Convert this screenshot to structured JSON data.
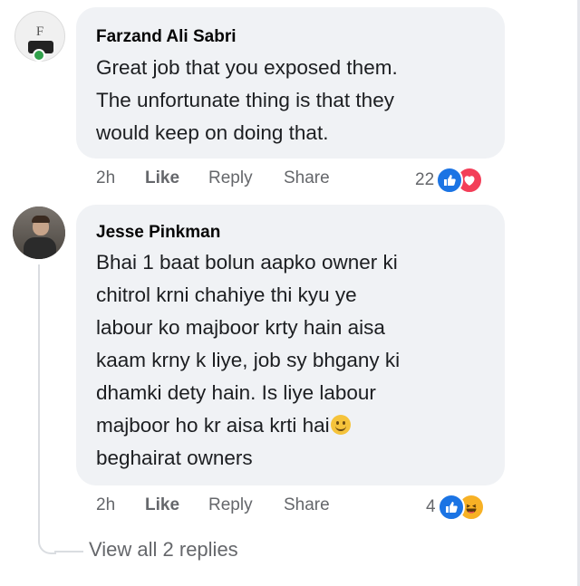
{
  "comments": [
    {
      "author": "Farzand Ali Sabri",
      "avatar_label": "F",
      "text_lines": [
        "Great job that you exposed them.",
        "The unfortunate thing is that they",
        "would keep on doing that."
      ],
      "time": "2h",
      "like_label": "Like",
      "reply_label": "Reply",
      "share_label": "Share",
      "reaction_count": "22",
      "reactions": [
        "like-icon",
        "heart-icon"
      ]
    },
    {
      "author": "Jesse Pinkman",
      "text_lines": [
        "Bhai 1 baat bolun aapko owner ki",
        "chitrol krni chahiye thi kyu ye",
        "labour ko majboor krty hain aisa",
        "kaam krny k liye, job sy bhgany ki",
        "dhamki dety hain. Is liye labour",
        "majboor ho kr aisa krti hai",
        "beghairat owners"
      ],
      "inline_emoji": "smiling-face-icon",
      "time": "2h",
      "like_label": "Like",
      "reply_label": "Reply",
      "share_label": "Share",
      "reaction_count": "4",
      "reactions": [
        "like-icon",
        "haha-icon"
      ],
      "view_replies_label": "View all 2 replies"
    }
  ],
  "colors": {
    "bubble": "#f0f2f5",
    "meta_text": "#65676b",
    "like_blue": "#1b74e4",
    "love_red": "#f33e58",
    "haha_yellow": "#f7b125",
    "online_green": "#31a24c"
  }
}
